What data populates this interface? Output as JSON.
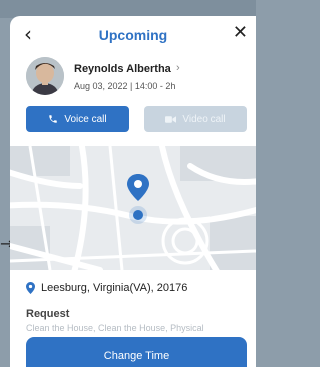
{
  "header": {
    "title": "Upcoming",
    "back_icon": "chevron-left-icon",
    "close_icon": "close-icon"
  },
  "profile": {
    "name": "Reynolds Albertha",
    "datetime": "Aug 03, 2022 | 14:00 - 2h",
    "chevron": "›"
  },
  "actions": {
    "voice_label": "Voice call",
    "video_label": "Video call"
  },
  "location": {
    "address": "Leesburg, Virginia(VA), 20176"
  },
  "request": {
    "label": "Request",
    "text": "Clean the House, Clean the House, Physical"
  },
  "footer": {
    "change_time_label": "Change Time"
  },
  "colors": {
    "accent": "#2f72c4",
    "disabled": "#c8d4df"
  }
}
